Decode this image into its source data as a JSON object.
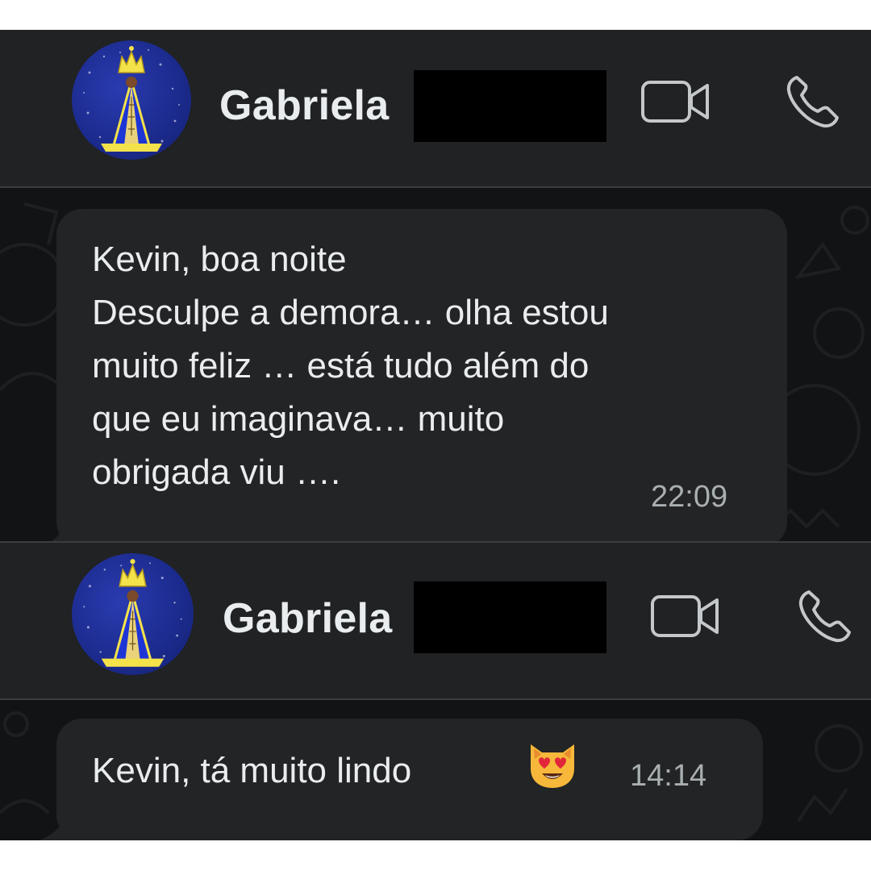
{
  "colors": {
    "header_bg": "#202223",
    "bubble_bg": "#222425",
    "wallpaper_bg": "#121314",
    "text": "#e9edef",
    "timestamp": "#a9aeb1",
    "redaction": "#000000"
  },
  "chats": [
    {
      "header": {
        "contact_name": "Gabriela",
        "avatar_icon": "saint-statue-avatar-icon",
        "video_call_icon": "video-camera-icon",
        "voice_call_icon": "phone-icon"
      },
      "message": {
        "text": "Kevin, boa noite\nDesculpe a demora… olha estou\nmuito feliz … está tudo além do\nque eu imaginava… muito\nobrigada viu ….",
        "time": "22:09"
      }
    },
    {
      "header": {
        "contact_name": "Gabriela",
        "avatar_icon": "saint-statue-avatar-icon",
        "video_call_icon": "video-camera-icon",
        "voice_call_icon": "phone-icon"
      },
      "message": {
        "text": "Kevin, tá muito lindo",
        "emoji": "heart-eyes-cat-emoji",
        "time": "14:14"
      }
    }
  ]
}
